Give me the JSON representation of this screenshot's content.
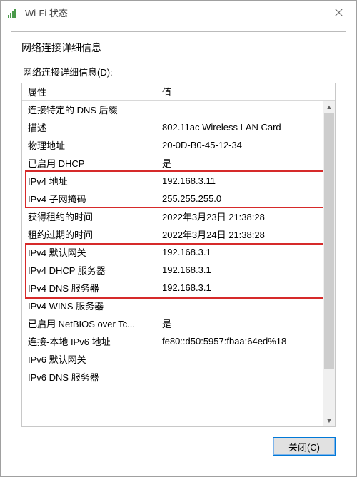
{
  "outer": {
    "title": "Wi-Fi 状态"
  },
  "dialog": {
    "title": "网络连接详细信息",
    "section_label": "网络连接详细信息(D):",
    "col_property": "属性",
    "col_value": "值",
    "close_button": "关闭(C)"
  },
  "rows": [
    {
      "property": "连接特定的 DNS 后缀",
      "value": ""
    },
    {
      "property": "描述",
      "value": "802.11ac Wireless LAN Card"
    },
    {
      "property": "物理地址",
      "value": "20-0D-B0-45-12-34"
    },
    {
      "property": "已启用 DHCP",
      "value": "是"
    },
    {
      "property": "IPv4 地址",
      "value": "192.168.3.11"
    },
    {
      "property": "IPv4 子网掩码",
      "value": "255.255.255.0"
    },
    {
      "property": "获得租约的时间",
      "value": "2022年3月23日 21:38:28"
    },
    {
      "property": "租约过期的时间",
      "value": "2022年3月24日 21:38:28"
    },
    {
      "property": "IPv4 默认网关",
      "value": "192.168.3.1"
    },
    {
      "property": "IPv4 DHCP 服务器",
      "value": "192.168.3.1"
    },
    {
      "property": "IPv4 DNS 服务器",
      "value": "192.168.3.1"
    },
    {
      "property": "IPv4 WINS 服务器",
      "value": ""
    },
    {
      "property": "已启用 NetBIOS over Tc...",
      "value": "是"
    },
    {
      "property": "连接-本地 IPv6 地址",
      "value": "fe80::d50:5957:fbaa:64ed%18"
    },
    {
      "property": "IPv6 默认网关",
      "value": ""
    },
    {
      "property": "IPv6 DNS 服务器",
      "value": ""
    }
  ],
  "highlights": [
    {
      "start": 4,
      "end": 5
    },
    {
      "start": 8,
      "end": 10
    }
  ]
}
